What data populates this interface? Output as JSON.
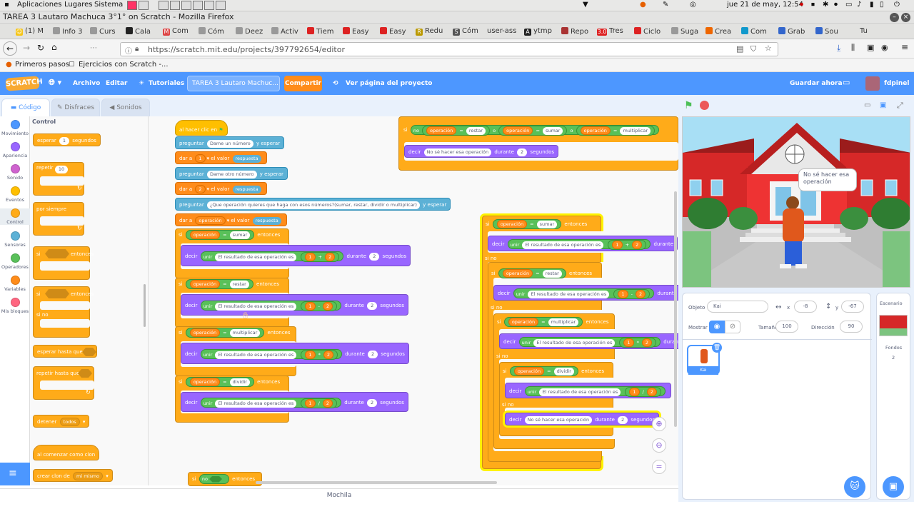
{
  "os": {
    "apps": "Aplicaciones",
    "places": "Lugares",
    "system": "Sistema",
    "clock": "jue 21 de may, 12:54"
  },
  "window": {
    "title": "TAREA 3 Lautaro Machuca 3°1° on Scratch - Mozilla Firefox"
  },
  "tabs": [
    "(1) M",
    "Info 3",
    "Curs",
    "Cala",
    "Com",
    "Cóm",
    "Deez",
    "Activ",
    "Tiem",
    "Easy",
    "Easy",
    "Redu",
    "Cóm",
    "user-ass",
    "ytmp",
    "Repo",
    "Tres",
    "Ciclo",
    "Suga",
    "Crea",
    "Com",
    "Grab",
    "Sou",
    "Tu"
  ],
  "tab_marks": {
    "m": "M",
    "sound": "3.0",
    "reddit": "R",
    "s": "S",
    "ai": "A"
  },
  "url": "https://scratch.mit.edu/projects/397792654/editor",
  "bookmarks": [
    "Primeros pasos",
    "Ejercicios con Scratch -..."
  ],
  "menu": {
    "logo": "SCRATCH",
    "file": "Archivo",
    "edit": "Editar",
    "tutorials": "Tutoriales",
    "project_title": "TAREA 3 Lautaro Machuc...",
    "share": "Compartir",
    "see_page": "Ver página del proyecto",
    "save": "Guardar ahora",
    "user": "fdpinel"
  },
  "editor_tabs": {
    "code": "Código",
    "costumes": "Disfraces",
    "sounds": "Sonidos"
  },
  "categories": [
    {
      "label": "Movimiento",
      "color": "#4c97ff"
    },
    {
      "label": "Apariencia",
      "color": "#9966ff"
    },
    {
      "label": "Sonido",
      "color": "#cf63cf"
    },
    {
      "label": "Eventos",
      "color": "#ffbf00"
    },
    {
      "label": "Control",
      "color": "#ffab19"
    },
    {
      "label": "Sensores",
      "color": "#5cb1d6"
    },
    {
      "label": "Operadores",
      "color": "#59c059"
    },
    {
      "label": "Variables",
      "color": "#ff8c1a"
    },
    {
      "label": "Mis bloques",
      "color": "#ff6680"
    }
  ],
  "palette": {
    "heading": "Control",
    "wait": "esperar",
    "wait_num": "1",
    "wait_unit": "segundos",
    "repeat": "repetir",
    "repeat_num": "10",
    "forever": "por siempre",
    "if": "si",
    "then": "entonces",
    "else": "si no",
    "wait_until": "esperar hasta que",
    "repeat_until": "repetir hasta que",
    "stop": "detener",
    "stop_opt": "todos",
    "clone_start": "al comenzar como clon",
    "clone_create": "crear clon de",
    "clone_opt": "mi mismo"
  },
  "script": {
    "hat": "al hacer clic en",
    "ask": "preguntar",
    "and_wait": "y esperar",
    "q1": "Dame un número",
    "q2": "Dame otro número",
    "q3": "¿Que operación quieres que haga con esos números?(sumar, restar, dividir o multiplicar)",
    "set": "dar a",
    "to": "el valor",
    "var1": "1",
    "var2": "2",
    "var_op": "operación",
    "answer": "respuesta",
    "if": "si",
    "then": "entonces",
    "else": "si no",
    "not": "no",
    "or": "o",
    "say": "decir",
    "join": "unir",
    "result": "El resultado de esa operación es",
    "for": "durante",
    "secs": "segundos",
    "two": "2",
    "one": "1",
    "ops": [
      {
        "name": "sumar",
        "sym": "+"
      },
      {
        "name": "restar",
        "sym": "-"
      },
      {
        "name": "multiplicar",
        "sym": "*"
      },
      {
        "name": "dividir",
        "sym": "/"
      }
    ],
    "eq": "=",
    "dont_know": "No sé hacer esa operación"
  },
  "mochila": "Mochila",
  "stage": {
    "bubble": "No sé hacer esa operación"
  },
  "sprite": {
    "obj_label": "Objeto",
    "name": "Kai",
    "x_label": "x",
    "x": "-8",
    "y_label": "y",
    "y": "-67",
    "show_label": "Mostrar",
    "size_label": "Tamaño",
    "size": "100",
    "dir_label": "Dirección",
    "dir": "90",
    "thumb_name": "Kai"
  },
  "scene": {
    "label": "Escenario",
    "backdrops_label": "Fondos",
    "backdrops": "2"
  },
  "colors": {
    "scratch_blue": "#4d97ff",
    "control": "#ffab19",
    "operator": "#59c059",
    "variable": "#ff8c1a",
    "looks": "#9966ff",
    "sensing": "#5cb1d6",
    "event": "#ffbf00",
    "highlight": "#fff200"
  }
}
